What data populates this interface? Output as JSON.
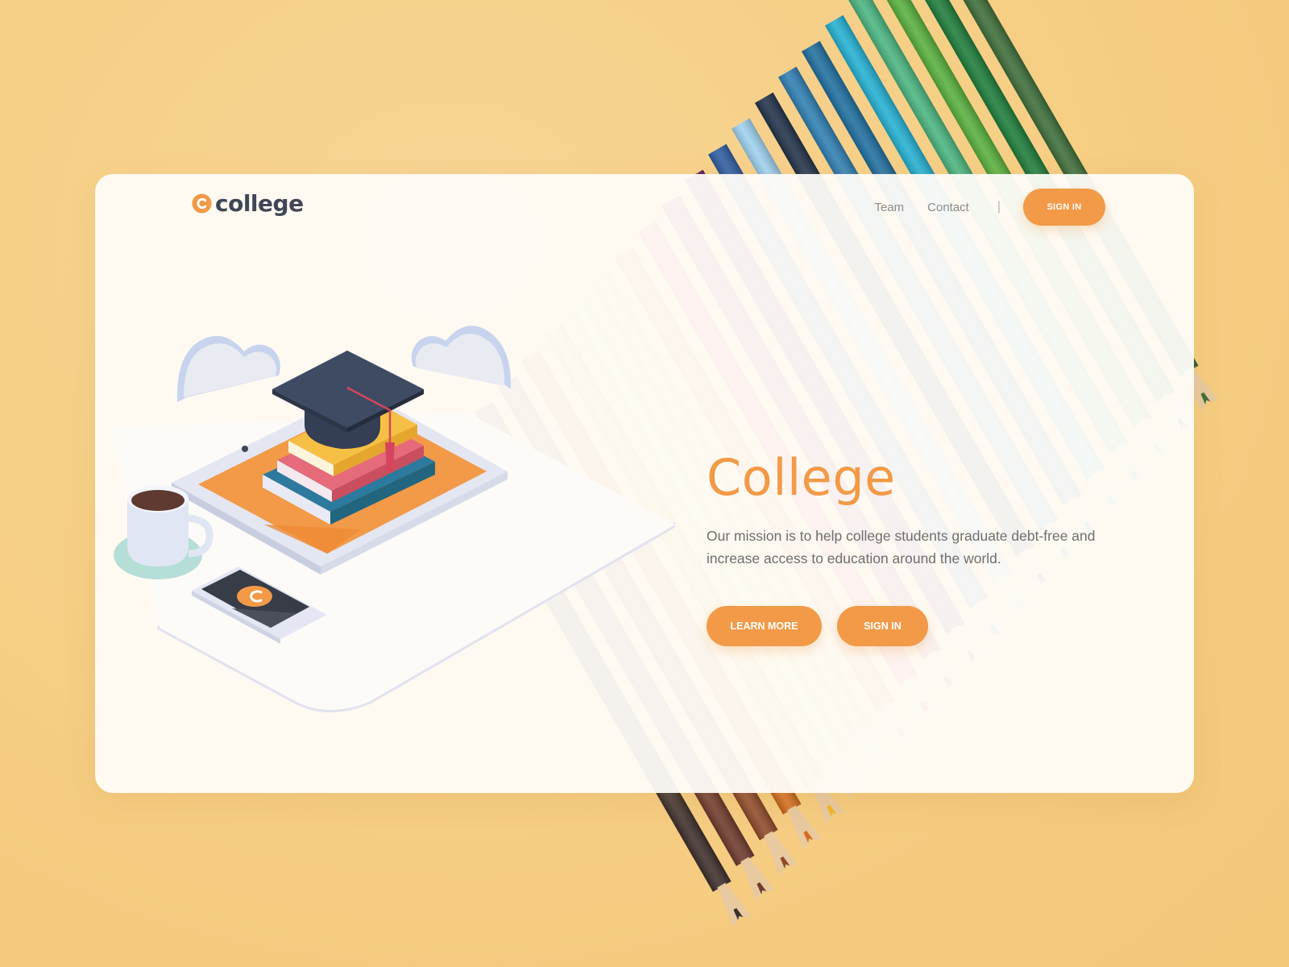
{
  "logo": {
    "text": "college",
    "mark_letter": "c"
  },
  "nav": {
    "links": [
      {
        "label": "Team"
      },
      {
        "label": "Contact"
      }
    ],
    "divider": "|",
    "signin_label": "SIGN IN"
  },
  "hero": {
    "title": "College",
    "description": "Our mission is to help college students graduate debt-free and increase access to education around the world.",
    "learn_more_label": "LEARN MORE",
    "signin_label": "SIGN IN"
  },
  "illustration": {
    "phone_mark_letter": "c"
  },
  "colors": {
    "accent": "#f29a47",
    "background": "#f6cf86",
    "card": "#fefcf8",
    "text_dark": "#3f4656",
    "text_muted": "#6e6e6e",
    "pencil_colors": [
      "#3e2f2c",
      "#6f3a2d",
      "#8f4a2a",
      "#d56c1e",
      "#f1b526",
      "#f6e153",
      "#f8d070",
      "#f08a2b",
      "#e6344a",
      "#9d1d4e",
      "#6a245e",
      "#2e5da3",
      "#9fd1f0",
      "#22324a",
      "#2f7fb3",
      "#1f6fa0",
      "#23b0d3",
      "#4ab580",
      "#58b03e",
      "#1e7d3b",
      "#3e6e3a"
    ]
  }
}
